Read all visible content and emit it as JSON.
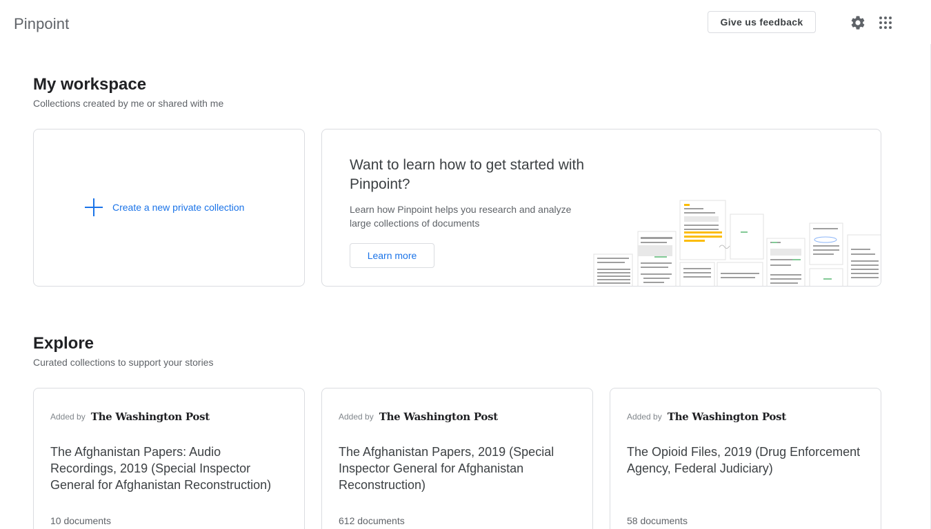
{
  "app": {
    "logo": "Pinpoint",
    "feedback_label": "Give us feedback",
    "settings_icon": "gear-icon",
    "apps_icon": "apps-grid-icon"
  },
  "workspace": {
    "title": "My workspace",
    "subtitle": "Collections created by me or shared with me",
    "create_label": "Create a new private collection",
    "learn": {
      "title": "Want to learn how to get started with Pinpoint?",
      "description": "Learn how Pinpoint helps you research and analyze large collections of documents",
      "button_label": "Learn more"
    }
  },
  "explore": {
    "title": "Explore",
    "subtitle": "Curated collections to support your stories",
    "collections": [
      {
        "added_label": "Added by",
        "publisher": "The Washington Post",
        "title": "The Afghanistan Papers: Audio Recordings, 2019 (Special Inspector General for Afghanistan Reconstruction)",
        "count": "10 documents"
      },
      {
        "added_label": "Added by",
        "publisher": "The Washington Post",
        "title": "The Afghanistan Papers, 2019 (Special Inspector General for Afghanistan Reconstruction)",
        "count": "612 documents"
      },
      {
        "added_label": "Added by",
        "publisher": "The Washington Post",
        "title": "The Opioid Files, 2019 (Drug Enforcement Agency, Federal Judiciary)",
        "count": "58 documents"
      }
    ]
  },
  "colors": {
    "accent": "#1a73e8",
    "text_primary": "#202124",
    "text_secondary": "#5f6368",
    "border": "#dadce0",
    "highlight_yellow": "#fbbc04",
    "highlight_green": "#34a853"
  }
}
